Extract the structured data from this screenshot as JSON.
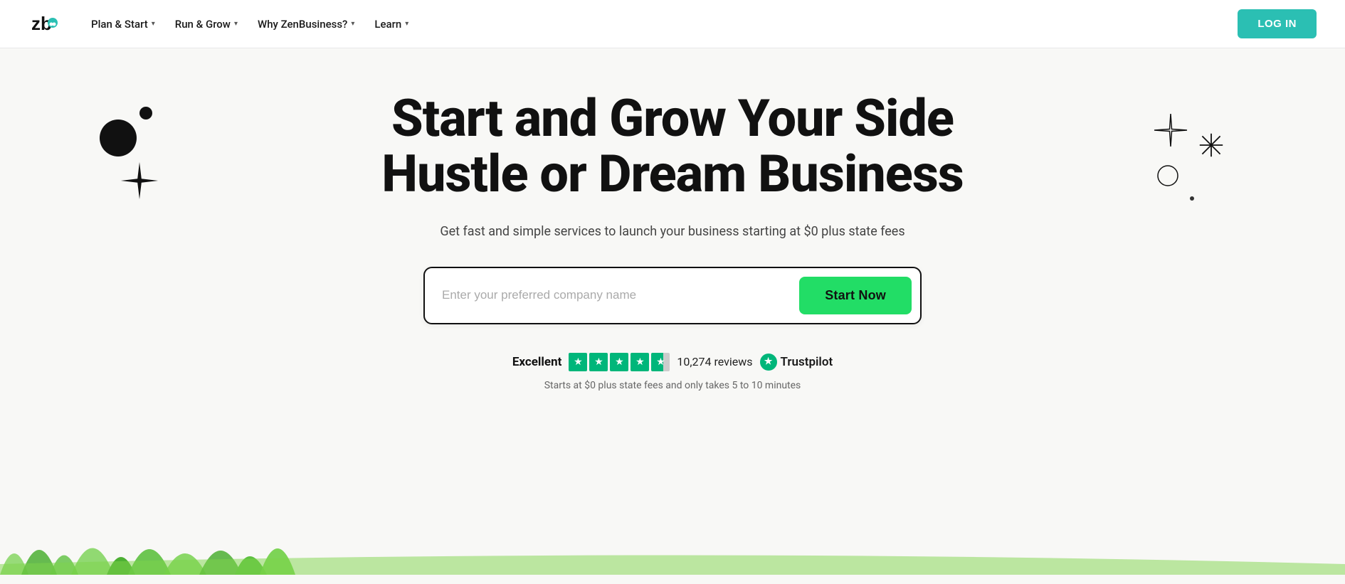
{
  "nav": {
    "logo_alt": "ZenBusiness",
    "items": [
      {
        "label": "Plan & Start",
        "has_chevron": true
      },
      {
        "label": "Run & Grow",
        "has_chevron": true
      },
      {
        "label": "Why ZenBusiness?",
        "has_chevron": true
      },
      {
        "label": "Learn",
        "has_chevron": true
      }
    ],
    "login_label": "LOG IN"
  },
  "hero": {
    "title_line1": "Start and Grow Your Side",
    "title_line2": "Hustle or Dream Business",
    "subtitle": "Get fast and simple services to launch your business starting at $0 plus state fees",
    "search_placeholder": "Enter your preferred company name",
    "start_button": "Start Now",
    "trust": {
      "excellent_label": "Excellent",
      "reviews_count": "10,274 reviews",
      "trustpilot_label": "Trustpilot",
      "fine_print": "Starts at $0 plus state fees and only takes 5 to 10 minutes"
    }
  }
}
